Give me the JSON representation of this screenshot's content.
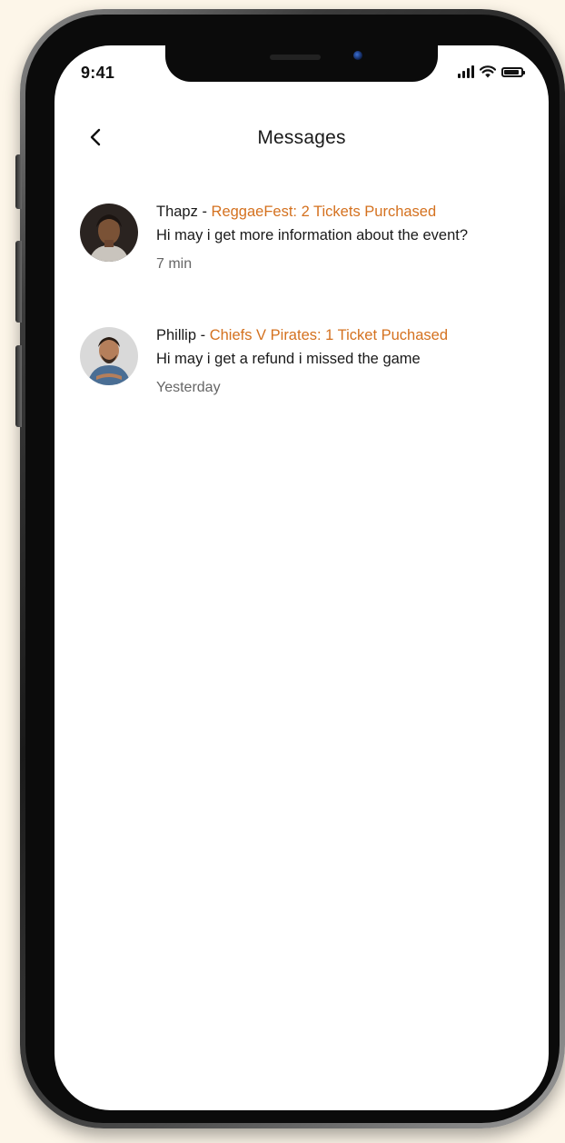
{
  "status_bar": {
    "time": "9:41"
  },
  "header": {
    "title": "Messages"
  },
  "messages": [
    {
      "sender": "Thapz",
      "separator": " - ",
      "event": "ReggaeFest: 2 Tickets Purchased",
      "text": "Hi may i get more information about the event?",
      "time": "7 min"
    },
    {
      "sender": "Phillip",
      "separator": " - ",
      "event": "Chiefs V Pirates: 1 Ticket Puchased",
      "text": "Hi may i get a refund i missed the game",
      "time": "Yesterday"
    }
  ],
  "colors": {
    "background": "#fdf6e9",
    "accent": "#d4711f",
    "text": "#1a1a1a",
    "muted": "#666666"
  }
}
